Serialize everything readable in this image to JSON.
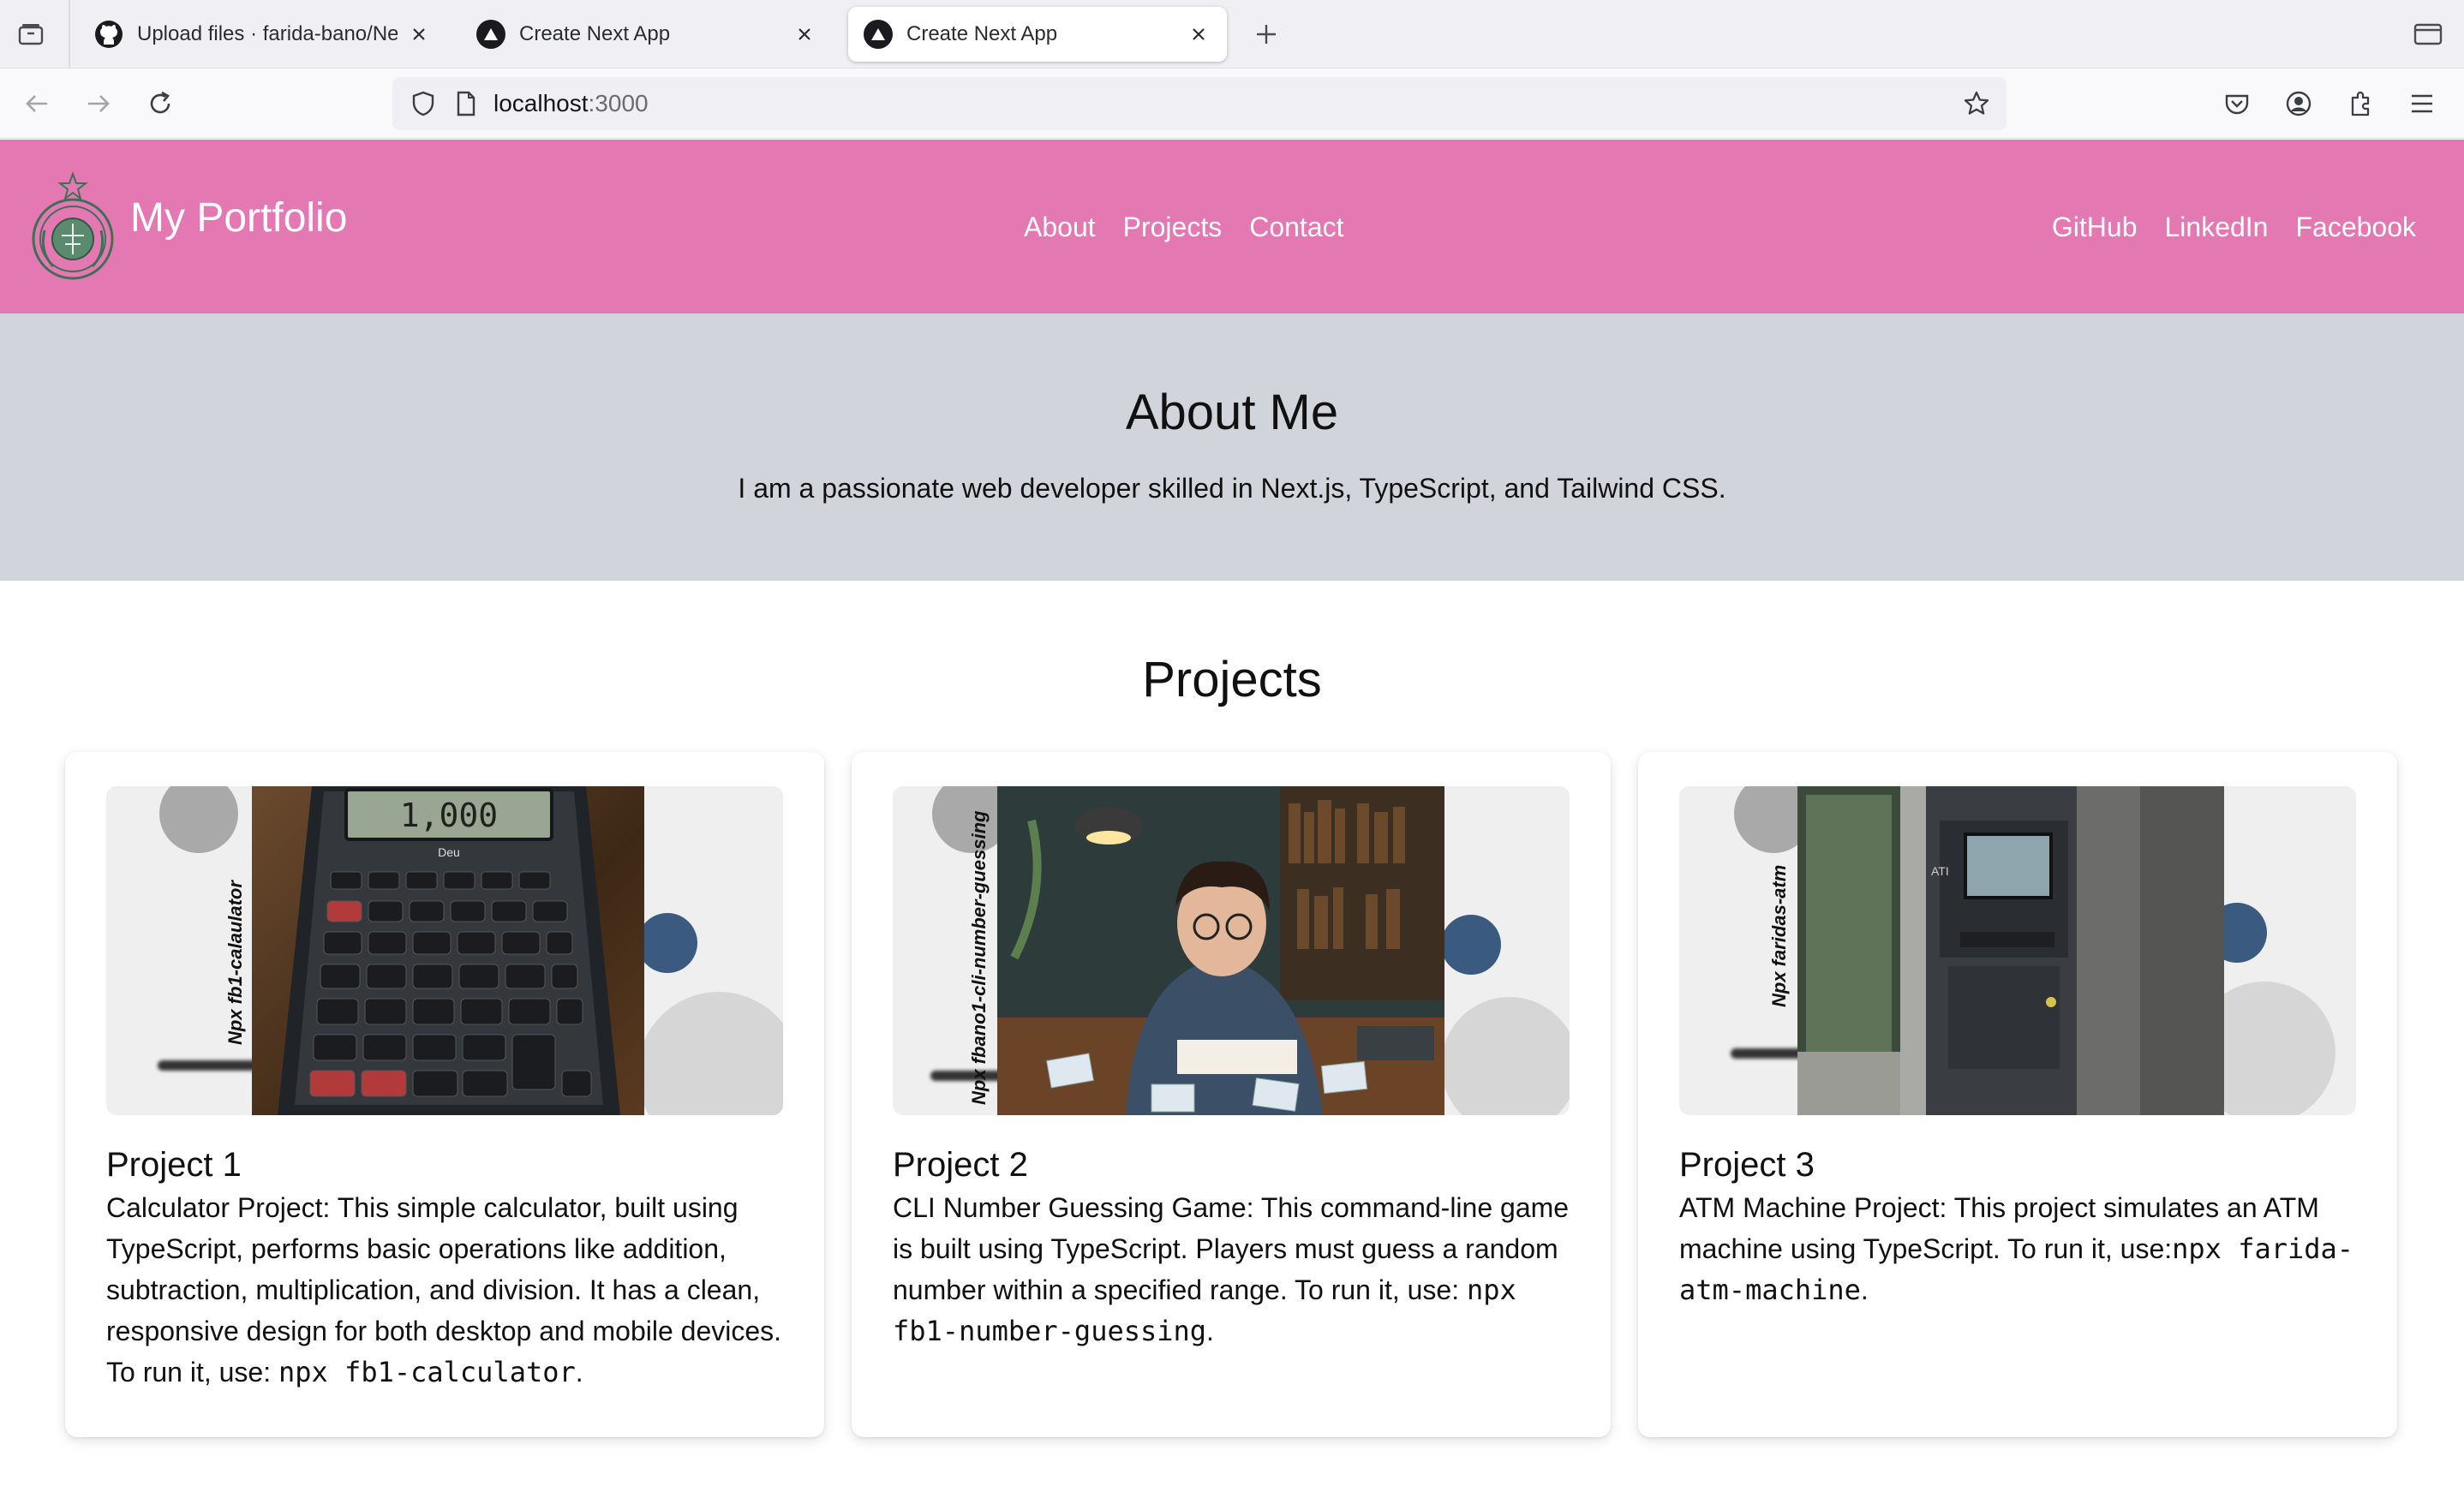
{
  "browser": {
    "tabs": [
      {
        "title": "Upload files · farida-bano/Next-js",
        "icon": "github-icon",
        "active": false
      },
      {
        "title": "Create Next App",
        "icon": "nextjs-triangle-icon",
        "active": false
      },
      {
        "title": "Create Next App",
        "icon": "nextjs-triangle-icon",
        "active": true
      }
    ],
    "url_host": "localhost",
    "url_port": ":3000"
  },
  "header": {
    "brand": "My Portfolio",
    "nav_center": [
      "About",
      "Projects",
      "Contact"
    ],
    "nav_social": [
      "GitHub",
      "LinkedIn",
      "Facebook"
    ]
  },
  "about": {
    "title": "About Me",
    "text": "I am a passionate web developer skilled in Next.js, TypeScript, and Tailwind CSS."
  },
  "projects": {
    "title": "Projects",
    "items": [
      {
        "title": "Project 1",
        "desc_prefix": "Calculator Project: This simple calculator, built using TypeScript, performs basic operations like addition, subtraction, multiplication, and division. It has a clean, responsive design for both desktop and mobile devices. To run it, use: ",
        "command": "npx fb1-calculator",
        "desc_suffix": ".",
        "image_label": "Npx fb1-calaulator",
        "screen_text": "1,000",
        "brand_text": "Deu"
      },
      {
        "title": "Project 2",
        "desc_prefix": "CLI Number Guessing Game: This command-line game is built using TypeScript. Players must guess a random number within a specified range. To run it, use: ",
        "command": "npx fb1-number-guessing",
        "desc_suffix": ".",
        "image_label": "Npx fbano1-cli-number-guessing"
      },
      {
        "title": "Project 3",
        "desc_prefix": "ATM Machine Project: This project simulates an ATM machine using TypeScript. To run it, use:",
        "command": "npx farida-atm-machine",
        "desc_suffix": ".",
        "image_label": "Npx faridas-atm",
        "sign_text": "ATI"
      }
    ]
  },
  "colors": {
    "header_bg": "#e478b2",
    "about_bg": "#d1d5db",
    "accent_circle": "#3a5a80"
  }
}
